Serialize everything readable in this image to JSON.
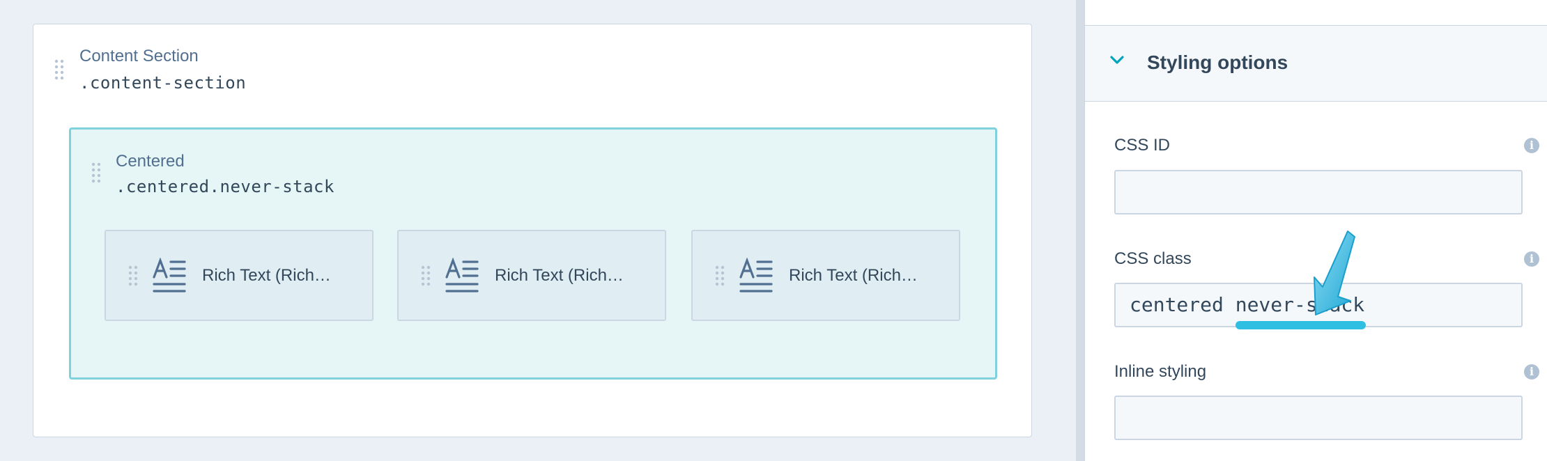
{
  "section": {
    "title": "Content Section",
    "class_name": ".content-section"
  },
  "row": {
    "title": "Centered",
    "class_name": ".centered.never-stack"
  },
  "modules": [
    {
      "label": "Rich Text (Rich…"
    },
    {
      "label": "Rich Text (Rich…"
    },
    {
      "label": "Rich Text (Rich…"
    }
  ],
  "panel": {
    "title": "Styling options",
    "fields": {
      "css_id": {
        "label": "CSS ID",
        "value": ""
      },
      "css_class": {
        "label": "CSS class",
        "value": "centered never-stack"
      },
      "inline_styling": {
        "label": "Inline styling",
        "value": ""
      }
    },
    "info_glyph": "i"
  },
  "colors": {
    "accent": "#00a4bd",
    "highlight": "#2fbfe3",
    "row_border": "#7fd1de",
    "row_bg": "#e6f6f6"
  }
}
